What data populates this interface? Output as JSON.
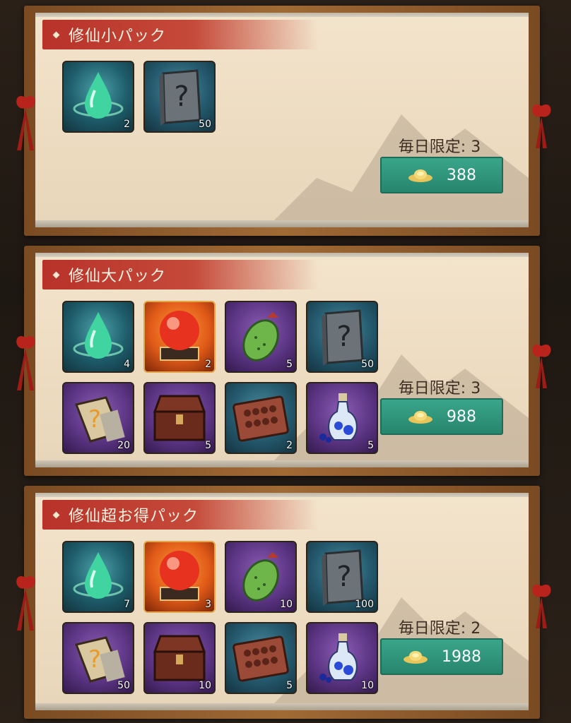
{
  "packs": [
    {
      "title": "修仙小パック",
      "limit": "毎日限定: 3",
      "price": "388",
      "items": [
        {
          "icon": "spirit-drop-icon",
          "bg": "blue",
          "count": "2"
        },
        {
          "icon": "mystery-book-icon",
          "bg": "teal",
          "count": "50"
        }
      ]
    },
    {
      "title": "修仙大パック",
      "limit": "毎日限定: 3",
      "price": "988",
      "items": [
        {
          "icon": "spirit-drop-icon",
          "bg": "blue",
          "count": "4"
        },
        {
          "icon": "red-orb-icon",
          "bg": "orange",
          "count": "2"
        },
        {
          "icon": "green-fruit-icon",
          "bg": "purple",
          "count": "5"
        },
        {
          "icon": "mystery-book-icon",
          "bg": "teal",
          "count": "50"
        },
        {
          "icon": "mystery-scroll-icon",
          "bg": "purple",
          "count": "20"
        },
        {
          "icon": "wooden-chest-icon",
          "bg": "purple",
          "count": "5"
        },
        {
          "icon": "abacus-icon",
          "bg": "teal",
          "count": "2"
        },
        {
          "icon": "blue-potion-icon",
          "bg": "purple",
          "count": "5"
        }
      ]
    },
    {
      "title": "修仙超お得パック",
      "limit": "毎日限定: 2",
      "price": "1988",
      "items": [
        {
          "icon": "spirit-drop-icon",
          "bg": "blue",
          "count": "7"
        },
        {
          "icon": "red-orb-icon",
          "bg": "orange",
          "count": "3"
        },
        {
          "icon": "green-fruit-icon",
          "bg": "purple",
          "count": "10"
        },
        {
          "icon": "mystery-book-icon",
          "bg": "teal",
          "count": "100"
        },
        {
          "icon": "mystery-scroll-icon",
          "bg": "purple",
          "count": "50"
        },
        {
          "icon": "wooden-chest-icon",
          "bg": "purple",
          "count": "10"
        },
        {
          "icon": "abacus-icon",
          "bg": "teal",
          "count": "5"
        },
        {
          "icon": "blue-potion-icon",
          "bg": "purple",
          "count": "10"
        }
      ]
    }
  ],
  "colors": {
    "title_bar": "#c0392b",
    "price_button": "#2f9a7d",
    "paper": "#efe0c6",
    "frame": "#8b5a2b"
  }
}
